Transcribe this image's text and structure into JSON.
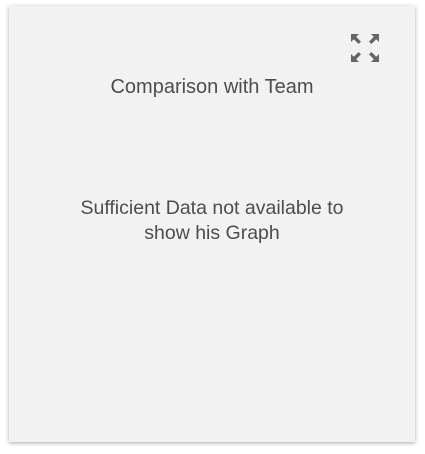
{
  "card": {
    "title": "Comparison with Team",
    "message": "Sufficient Data not available to show his Graph",
    "expand_icon": "fullscreen-expand-icon"
  },
  "colors": {
    "card_background": "#f2f2f2",
    "text": "#4d4d4d",
    "icon": "#666666"
  }
}
